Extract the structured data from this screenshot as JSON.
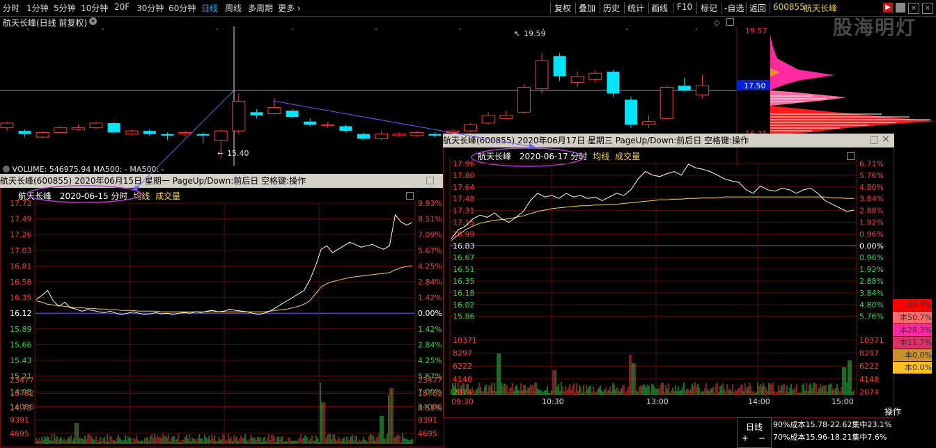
{
  "toolbar": {
    "periods": [
      "分时",
      "1分钟",
      "5分钟",
      "10分钟",
      "20F",
      "30分钟",
      "60分钟",
      "日线",
      "周线",
      "多周期",
      "更多 ›"
    ],
    "active": "日线",
    "right_buttons": [
      "复权",
      "叠加",
      "历史",
      "统计",
      "画线",
      "F10",
      "标记",
      "-自选",
      "返回"
    ],
    "stock_code": "600855",
    "stock_name": "航天长峰",
    "watermark": "股海明灯"
  },
  "kline": {
    "title": "航天长峰(日线 前复权)",
    "high_label": "19.59",
    "low_label": "15.40",
    "price_axis": [
      "19.57",
      "17.50"
    ],
    "current_tag": "17.50",
    "bottom_tick_partial": "16.21",
    "volume_label": "VOLUME: 546975.94  MA500: -  MA500: -"
  },
  "panel1": {
    "header": "航天长峰(600855)  2020年06月15日  星期一  PageUp/Down:前后日  空格键:操作",
    "subtitle_name": "航天长峰",
    "subtitle_date": "2020-06-15 分时",
    "subtitle_avg": "均线",
    "subtitle_vol": "成交量",
    "left_prices": [
      "17.72",
      "17.49",
      "17.26",
      "17.03",
      "16.81",
      "16.58",
      "16.35",
      "16.12",
      "15.89",
      "15.66",
      "15.43",
      "15.21",
      "14.98",
      "14.75"
    ],
    "right_pcts": [
      "9.93%",
      "8.51%",
      "7.09%",
      "5.67%",
      "4.25%",
      "2.84%",
      "1.42%",
      "0.00%",
      "1.42%",
      "2.84%",
      "4.25%",
      "5.67%",
      "7.09%",
      "8.51%"
    ],
    "vol_ticks": [
      "23477",
      "18782",
      "14086",
      "9391",
      "4695"
    ],
    "price_series": [
      16.32,
      16.38,
      16.45,
      16.3,
      16.22,
      16.28,
      16.2,
      16.18,
      16.15,
      16.17,
      16.16,
      16.14,
      16.13,
      16.15,
      16.12,
      16.1,
      16.12,
      16.14,
      16.12,
      16.1,
      16.11,
      16.13,
      16.11,
      16.12,
      16.1,
      16.12,
      16.13,
      16.12,
      16.14,
      16.13,
      16.15,
      16.16,
      16.14,
      16.15,
      16.18,
      16.16,
      16.15,
      16.14,
      16.12,
      16.1,
      16.12,
      16.15,
      16.2,
      16.25,
      16.3,
      16.35,
      16.4,
      16.45,
      16.6,
      16.8,
      17.05,
      17.1,
      17.0,
      17.05,
      17.1,
      17.15,
      17.12,
      17.08,
      17.1,
      17.12,
      17.08,
      17.05,
      17.1,
      17.55,
      17.45,
      17.4,
      17.44
    ],
    "avg_series": [
      16.3,
      16.28,
      16.25,
      16.24,
      16.23,
      16.22,
      16.21,
      16.2,
      16.2,
      16.19,
      16.19,
      16.18,
      16.18,
      16.17,
      16.17,
      16.16,
      16.16,
      16.16,
      16.15,
      16.15,
      16.15,
      16.15,
      16.14,
      16.14,
      16.14,
      16.14,
      16.14,
      16.14,
      16.14,
      16.14,
      16.14,
      16.14,
      16.14,
      16.14,
      16.14,
      16.14,
      16.14,
      16.14,
      16.14,
      16.14,
      16.14,
      16.15,
      16.16,
      16.17,
      16.18,
      16.2,
      16.22,
      16.25,
      16.3,
      16.4,
      16.5,
      16.55,
      16.58,
      16.6,
      16.62,
      16.64,
      16.65,
      16.66,
      16.67,
      16.68,
      16.69,
      16.7,
      16.71,
      16.75,
      16.78,
      16.8,
      16.81
    ]
  },
  "panel2": {
    "header": "航天长峰(600855)  2020年06月17日  星期三  PageUp/Down:前后日  空格键:操作",
    "subtitle_name": "航天长峰",
    "subtitle_date": "2020-06-17 分时",
    "subtitle_avg": "均线",
    "subtitle_vol": "成交量",
    "left_prices": [
      "17.96",
      "17.80",
      "17.64",
      "17.48",
      "17.31",
      "17.15",
      "16.99",
      "16.83",
      "16.67",
      "16.51",
      "16.35",
      "16.18",
      "16.02",
      "15.86"
    ],
    "right_pcts": [
      "6.71%",
      "5.76%",
      "4.80%",
      "3.84%",
      "2.88%",
      "1.92%",
      "0.96%",
      "0.00%",
      "0.96%",
      "1.92%",
      "2.88%",
      "3.84%",
      "4.80%",
      "5.76%"
    ],
    "vol_ticks": [
      "10371",
      "8297",
      "6222",
      "4148",
      "2074"
    ],
    "time_ticks": [
      "09:30",
      "10:30",
      "13:00",
      "14:00",
      "15:00"
    ],
    "price_series": [
      16.93,
      17.05,
      17.1,
      17.2,
      17.25,
      17.22,
      17.28,
      17.2,
      17.15,
      17.22,
      17.3,
      17.45,
      17.55,
      17.5,
      17.52,
      17.48,
      17.55,
      17.5,
      17.52,
      17.48,
      17.5,
      17.45,
      17.5,
      17.55,
      17.52,
      17.6,
      17.75,
      17.85,
      17.8,
      17.78,
      17.82,
      17.85,
      17.8,
      17.95,
      17.9,
      17.88,
      17.85,
      17.8,
      17.75,
      17.72,
      17.7,
      17.6,
      17.55,
      17.65,
      17.6,
      17.58,
      17.62,
      17.6,
      17.55,
      17.6,
      17.62,
      17.55,
      17.45,
      17.4,
      17.35,
      17.3,
      17.32
    ],
    "avg_series": [
      16.9,
      16.98,
      17.05,
      17.1,
      17.14,
      17.16,
      17.18,
      17.19,
      17.2,
      17.22,
      17.24,
      17.27,
      17.3,
      17.32,
      17.34,
      17.35,
      17.36,
      17.37,
      17.38,
      17.38,
      17.39,
      17.39,
      17.4,
      17.4,
      17.41,
      17.42,
      17.43,
      17.44,
      17.45,
      17.46,
      17.46,
      17.47,
      17.47,
      17.48,
      17.48,
      17.49,
      17.49,
      17.49,
      17.5,
      17.5,
      17.5,
      17.5,
      17.5,
      17.5,
      17.5,
      17.5,
      17.5,
      17.5,
      17.5,
      17.5,
      17.5,
      17.5,
      17.5,
      17.49,
      17.49,
      17.48,
      17.48
    ]
  },
  "chips": {
    "legend": [
      "68.7%",
      "本50.7%",
      "本28.3%",
      "本11.7%",
      "本0.0%",
      "本0.0%"
    ],
    "legend_colors": [
      "#ff0000",
      "#ff6a6a",
      "#ff2aa0",
      "#e0306a",
      "#c89030",
      "#ffc020"
    ],
    "op_label": "操作",
    "tab_label": "日线",
    "line1": "90%成本15.78-22.62集中23.1%",
    "line2": "70%成本15.96-18.21集中7.6%"
  },
  "candles": [
    {
      "o": 16.4,
      "c": 16.55,
      "h": 16.6,
      "l": 16.3
    },
    {
      "o": 16.3,
      "c": 16.2,
      "h": 16.35,
      "l": 16.1
    },
    {
      "o": 16.1,
      "c": 16.25,
      "h": 16.3,
      "l": 16.05
    },
    {
      "o": 16.25,
      "c": 16.4,
      "h": 16.45,
      "l": 16.2
    },
    {
      "o": 16.35,
      "c": 16.4,
      "h": 16.5,
      "l": 16.3
    },
    {
      "o": 16.4,
      "c": 16.55,
      "h": 16.6,
      "l": 16.35
    },
    {
      "o": 16.55,
      "c": 16.25,
      "h": 16.6,
      "l": 16.2
    },
    {
      "o": 16.2,
      "c": 16.3,
      "h": 16.35,
      "l": 16.15
    },
    {
      "o": 16.3,
      "c": 16.2,
      "h": 16.35,
      "l": 16.15
    },
    {
      "o": 16.2,
      "c": 16.15,
      "h": 16.25,
      "l": 16.0
    },
    {
      "o": 16.2,
      "c": 16.25,
      "h": 16.3,
      "l": 16.1
    },
    {
      "o": 16.2,
      "c": 16.15,
      "h": 16.25,
      "l": 15.9
    },
    {
      "o": 16.0,
      "c": 16.3,
      "h": 16.35,
      "l": 15.4
    },
    {
      "o": 16.3,
      "c": 17.25,
      "h": 17.5,
      "l": 16.2
    },
    {
      "o": 16.9,
      "c": 16.8,
      "h": 17.0,
      "l": 16.7
    },
    {
      "o": 16.85,
      "c": 17.05,
      "h": 17.35,
      "l": 16.8
    },
    {
      "o": 16.95,
      "c": 16.75,
      "h": 17.0,
      "l": 16.7
    },
    {
      "o": 16.6,
      "c": 16.5,
      "h": 16.7,
      "l": 16.45
    },
    {
      "o": 16.5,
      "c": 16.5,
      "h": 16.6,
      "l": 16.4
    },
    {
      "o": 16.45,
      "c": 16.3,
      "h": 16.5,
      "l": 16.25
    },
    {
      "o": 16.2,
      "c": 16.05,
      "h": 16.25,
      "l": 16.0
    },
    {
      "o": 16.05,
      "c": 16.2,
      "h": 16.3,
      "l": 16.0
    },
    {
      "o": 16.15,
      "c": 16.2,
      "h": 16.25,
      "l": 16.1
    },
    {
      "o": 16.15,
      "c": 16.25,
      "h": 16.3,
      "l": 16.1
    },
    {
      "o": 16.2,
      "c": 16.15,
      "h": 16.25,
      "l": 16.1
    },
    {
      "o": 16.25,
      "c": 16.3,
      "h": 16.35,
      "l": 16.2
    },
    {
      "o": 16.3,
      "c": 16.5,
      "h": 16.55,
      "l": 16.25
    },
    {
      "o": 16.55,
      "c": 16.8,
      "h": 16.9,
      "l": 16.5
    },
    {
      "o": 16.7,
      "c": 16.8,
      "h": 16.95,
      "l": 16.65
    },
    {
      "o": 16.9,
      "c": 17.7,
      "h": 17.8,
      "l": 16.85
    },
    {
      "o": 17.65,
      "c": 18.55,
      "h": 18.8,
      "l": 17.5
    },
    {
      "o": 18.7,
      "c": 18.05,
      "h": 18.8,
      "l": 17.9
    },
    {
      "o": 17.85,
      "c": 18.05,
      "h": 18.2,
      "l": 17.7
    },
    {
      "o": 17.95,
      "c": 18.15,
      "h": 18.25,
      "l": 17.85
    },
    {
      "o": 18.2,
      "c": 17.5,
      "h": 18.25,
      "l": 17.4
    },
    {
      "o": 17.3,
      "c": 16.5,
      "h": 17.4,
      "l": 16.4
    },
    {
      "o": 16.5,
      "c": 16.6,
      "h": 16.8,
      "l": 16.4
    },
    {
      "o": 16.7,
      "c": 17.7,
      "h": 17.75,
      "l": 16.65
    },
    {
      "o": 17.75,
      "c": 17.6,
      "h": 18.0,
      "l": 17.55
    },
    {
      "o": 17.45,
      "c": 17.75,
      "h": 18.1,
      "l": 17.35
    }
  ]
}
